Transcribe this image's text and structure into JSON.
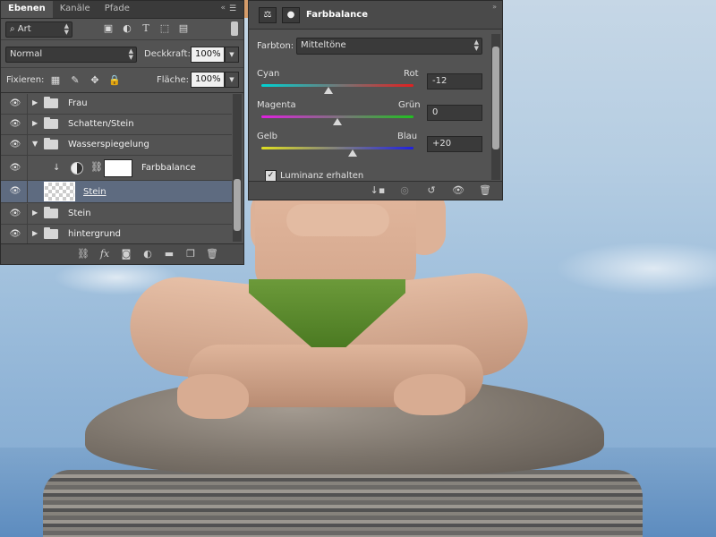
{
  "layers_panel": {
    "tabs": [
      "Ebenen",
      "Kanäle",
      "Pfade"
    ],
    "filter": {
      "kind_label": "Art"
    },
    "blend_mode": "Normal",
    "opacity": {
      "label": "Deckkraft:",
      "value": "100%"
    },
    "lock": {
      "label": "Fixieren:"
    },
    "fill": {
      "label": "Fläche:",
      "value": "100%"
    },
    "layers": [
      {
        "name": "Frau",
        "type": "group"
      },
      {
        "name": "Schatten/Stein",
        "type": "group"
      },
      {
        "name": "Wasserspiegelung",
        "type": "group-open"
      },
      {
        "name": "Farbbalance",
        "type": "adjustment"
      },
      {
        "name": "Stein",
        "type": "pixel",
        "selected": true
      },
      {
        "name": "Stein",
        "type": "group"
      },
      {
        "name": "hintergrund",
        "type": "group"
      }
    ]
  },
  "properties_panel": {
    "title": "Farbbalance",
    "tone": {
      "label": "Farbton:",
      "value": "Mitteltöne"
    },
    "sliders": [
      {
        "left": "Cyan",
        "right": "Rot",
        "value": "-12",
        "colors": [
          "#00d2d2",
          "#e02020"
        ],
        "level": -12
      },
      {
        "left": "Magenta",
        "right": "Grün",
        "value": "0",
        "colors": [
          "#e020e0",
          "#20c020"
        ],
        "level": 0
      },
      {
        "left": "Gelb",
        "right": "Blau",
        "value": "+20",
        "colors": [
          "#e0e020",
          "#2020e0"
        ],
        "level": 20
      }
    ],
    "preserve_luminosity": {
      "label": "Luminanz erhalten",
      "checked": true
    }
  }
}
